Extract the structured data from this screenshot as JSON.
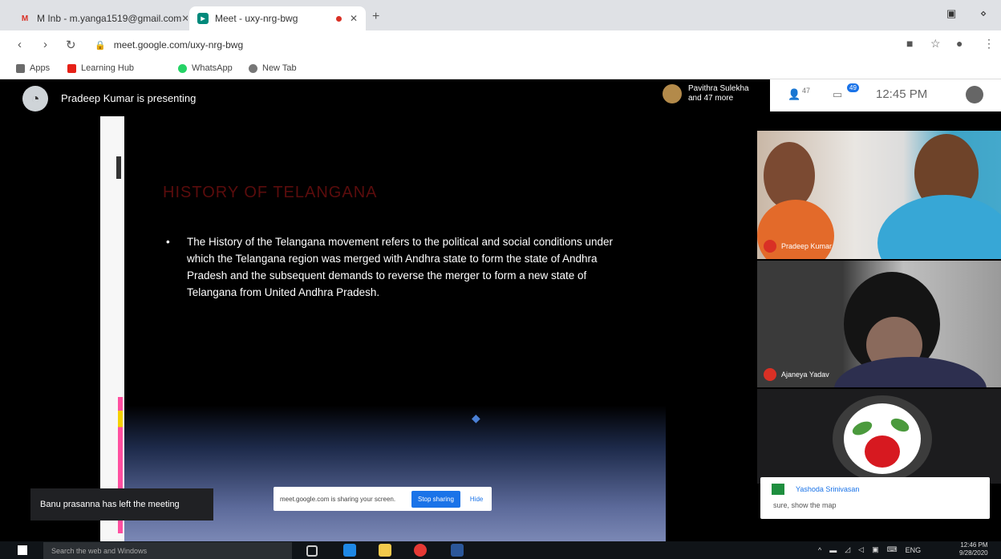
{
  "browser": {
    "tabs": [
      {
        "title": "M Inb - m.yanga1519@gmail.com",
        "icon": "gmail-icon"
      },
      {
        "title": "Meet - uxy-nrg-bwg",
        "icon": "meet-icon",
        "recording": true
      }
    ],
    "new_tab": "+",
    "url": "meet.google.com/uxy-nrg-bwg",
    "bookmarks": [
      {
        "label": "Apps",
        "color": "#6b6b6b"
      },
      {
        "label": "Learning Hub",
        "color": "#e62117"
      },
      {
        "label": "WhatsApp",
        "color": "#25d366"
      },
      {
        "label": "New Tab",
        "color": "#777777"
      }
    ]
  },
  "meet": {
    "presenter_text": "Pradeep Kumar is presenting",
    "others_line1": "Pavithra Sulekha",
    "others_line2": "and 47 more",
    "participants_count": "47",
    "chat_badge": "49",
    "time": "12:45 PM",
    "slide": {
      "title": "HISTORY OF TELANGANA",
      "bullet": "The History of the Telangana movement refers to the political and social conditions under which the Telangana region was merged with Andhra state to form the state of Andhra Pradesh and the subsequent demands to reverse the merger to form a new state of Telangana from United Andhra Pradesh."
    },
    "share_bar": {
      "message": "meet.google.com is sharing your screen.",
      "stop_label": "Stop sharing",
      "hide_label": "Hide"
    },
    "toast": "Banu prasanna has left the meeting",
    "tiles": [
      {
        "name": "Pradeep Kumar"
      },
      {
        "name": "Ajaneya Yadav"
      }
    ],
    "notification": {
      "sender": "Yashoda Srinivasan",
      "body": "sure, show the map"
    }
  },
  "taskbar": {
    "search_placeholder": "Search the web and Windows",
    "language": "ENG",
    "clock_time": "12:46 PM",
    "clock_date": "9/28/2020"
  },
  "colors": {
    "accent": "#1a73e8",
    "slide_title": "#5a0c0c",
    "mic_off": "#d93025"
  }
}
